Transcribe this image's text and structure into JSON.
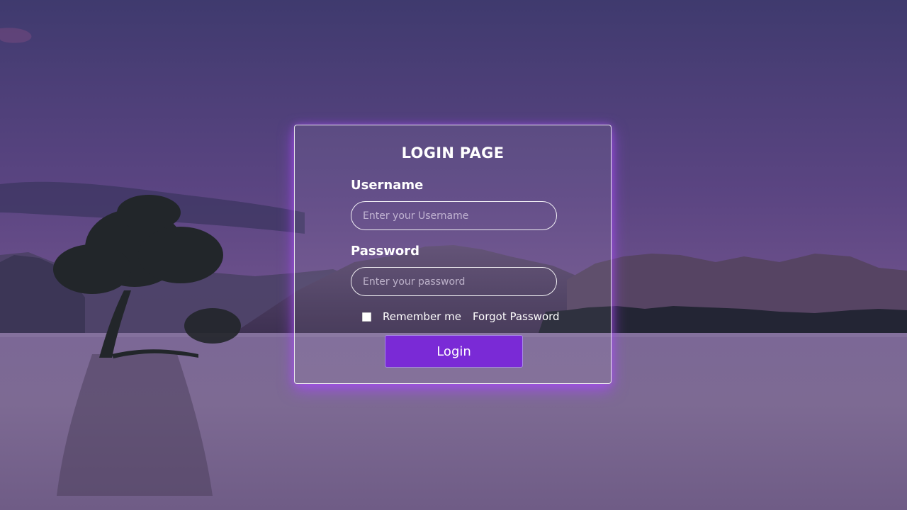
{
  "login": {
    "title": "LOGIN PAGE",
    "username_label": "Username",
    "username_placeholder": "Enter your Username",
    "password_label": "Password",
    "password_placeholder": "Enter your password",
    "remember_label": "Remember me",
    "forgot_label": "Forgot Password",
    "button_label": "Login",
    "accent_color": "#7a2ad6",
    "glow_color": "#aa46ff"
  }
}
